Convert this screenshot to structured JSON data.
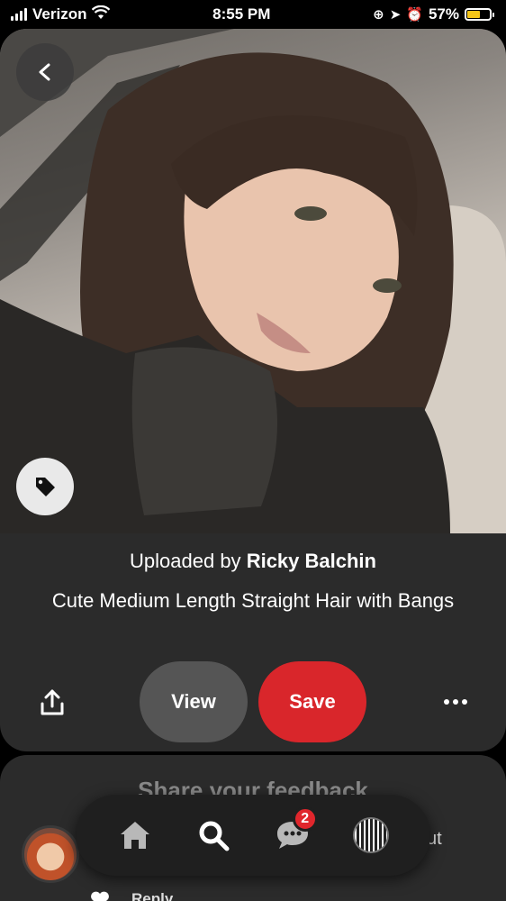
{
  "status_bar": {
    "carrier": "Verizon",
    "time": "8:55 PM",
    "battery_percent": "57%",
    "battery_level": 0.57,
    "battery_color": "#f5c518",
    "icons": [
      "signal-icon",
      "wifi-icon",
      "orientation-lock-icon",
      "location-icon",
      "alarm-icon",
      "battery-icon"
    ]
  },
  "pin": {
    "uploaded_prefix": "Uploaded by",
    "uploader": "Ricky Balchin",
    "title": "Cute Medium Length Straight Hair with Bangs",
    "image_description_icon": "photo"
  },
  "actions": {
    "view_label": "View",
    "save_label": "Save",
    "save_color": "#d9262b",
    "view_color": "#555555"
  },
  "feedback": {
    "title": "Share your feedback",
    "comment_fragment": "ut",
    "reply_label": "Reply"
  },
  "bottom_nav": {
    "items": [
      "home-icon",
      "search-icon",
      "messages-icon",
      "profile-icon"
    ],
    "messages_badge": "2",
    "badge_color": "#e0262c"
  }
}
